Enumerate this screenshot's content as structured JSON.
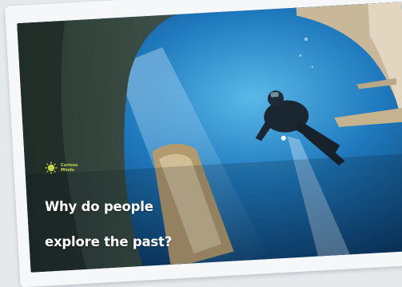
{
  "brand": {
    "name": "Curious Minds"
  },
  "headline": {
    "line1": "Why do people",
    "line2": "explore the past?"
  },
  "colors": {
    "accent": "#c6d64b",
    "water_deep": "#0b3f6b",
    "water_light": "#3fa2d8",
    "card": "#f6f7f8",
    "background": "#e6e9ec"
  }
}
